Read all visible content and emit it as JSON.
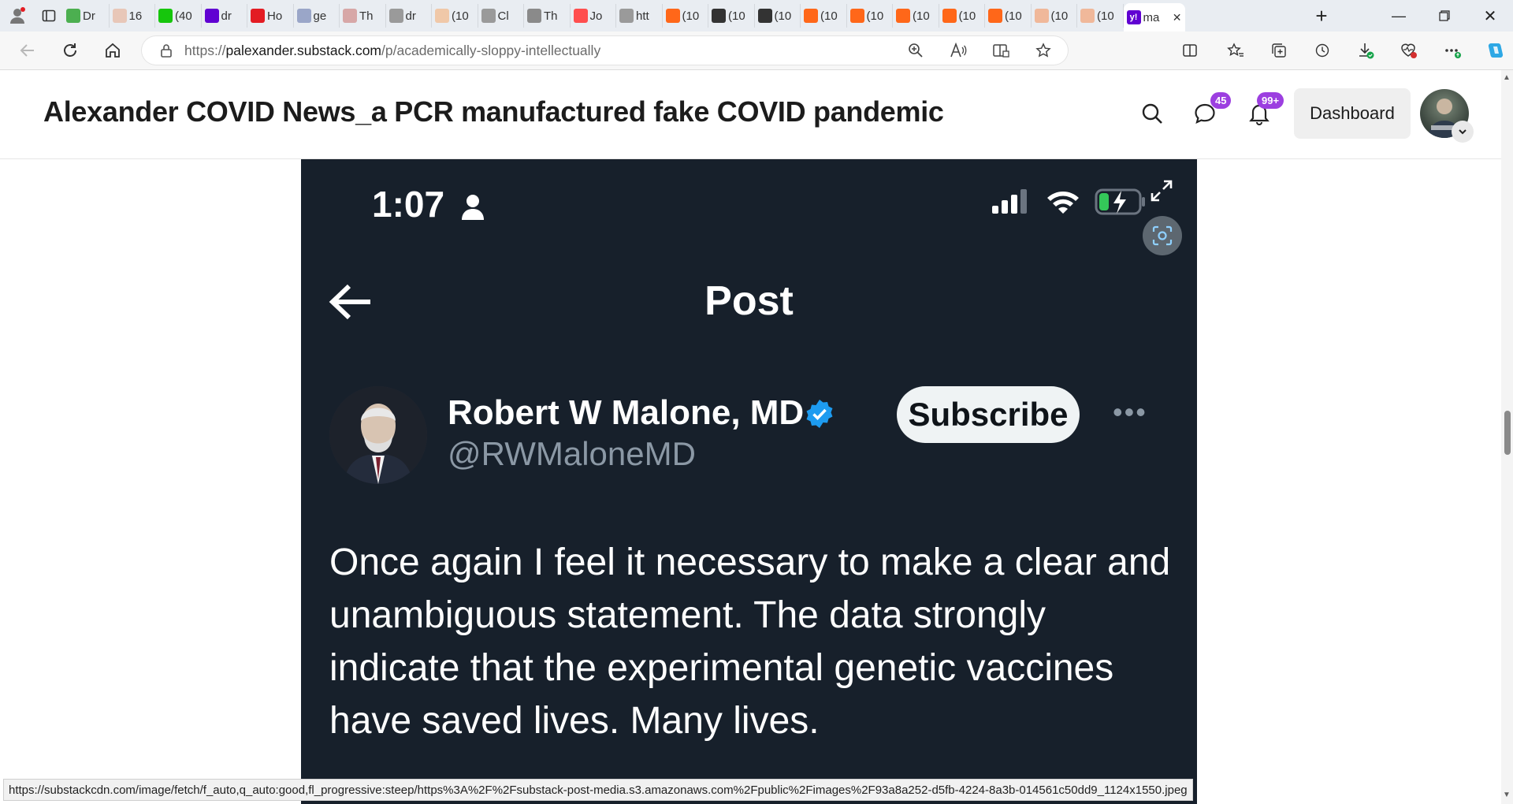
{
  "browser": {
    "tabs": [
      {
        "label": "Dr",
        "icon": "play-icon",
        "color": "#4caf50"
      },
      {
        "label": "16",
        "icon": "bi-icon",
        "color": "#e8c7b8"
      },
      {
        "label": "(40",
        "icon": "g-icon",
        "color": "#16c60c"
      },
      {
        "label": "dr",
        "icon": "yahoo-icon",
        "color": "#6001d2"
      },
      {
        "label": "Ho",
        "icon": "red-icon",
        "color": "#e31c23"
      },
      {
        "label": "ge",
        "icon": "search-icon",
        "color": "#9aa6c8"
      },
      {
        "label": "Th",
        "icon": "ds-icon",
        "color": "#d7a7a7"
      },
      {
        "label": "dr",
        "icon": "file-icon",
        "color": "#9a9a9a"
      },
      {
        "label": "(10",
        "icon": "bookmark-icon",
        "color": "#f0c8a8"
      },
      {
        "label": "Cl",
        "icon": "page-icon",
        "color": "#9a9a9a"
      },
      {
        "label": "Th",
        "icon": "tr-icon",
        "color": "#8a8a8a"
      },
      {
        "label": "Jo",
        "icon": "youtube-icon",
        "color": "#ff4e4e"
      },
      {
        "label": "htt",
        "icon": "page-icon",
        "color": "#9a9a9a"
      },
      {
        "label": "(10",
        "icon": "substack-icon",
        "color": "#ff6719"
      },
      {
        "label": "(10",
        "icon": "photo-icon",
        "color": "#333333"
      },
      {
        "label": "(10",
        "icon": "photo-icon",
        "color": "#333333"
      },
      {
        "label": "(10",
        "icon": "substack-icon",
        "color": "#ff6719"
      },
      {
        "label": "(10",
        "icon": "substack-icon",
        "color": "#ff6719"
      },
      {
        "label": "(10",
        "icon": "substack-icon",
        "color": "#ff6719"
      },
      {
        "label": "(10",
        "icon": "substack-icon",
        "color": "#ff6719"
      },
      {
        "label": "(10",
        "icon": "substack-icon",
        "color": "#ff6719"
      },
      {
        "label": "(10",
        "icon": "substack-icon",
        "color": "#f0b89a"
      },
      {
        "label": "(10",
        "icon": "substack-icon",
        "color": "#f0b89a"
      }
    ],
    "active_tab": {
      "label": "ma",
      "icon": "yahoo-icon",
      "color": "#6001d2",
      "close": "✕"
    },
    "new_tab": "+",
    "url_prefix": "https://",
    "url_host": "palexander.substack.com",
    "url_path": "/p/academically-sloppy-intellectually",
    "status_url": "https://substackcdn.com/image/fetch/f_auto,q_auto:good,fl_progressive:steep/https%3A%2F%2Fsubstack-post-media.s3.amazonaws.com%2Fpublic%2Fimages%2F93a8a252-d5fb-4224-8a3b-014561c50dd9_1124x1550.jpeg"
  },
  "header": {
    "title": "Alexander COVID News_a PCR manufactured fake COVID pandemic",
    "chat_badge": "45",
    "notif_badge": "99+",
    "dashboard_label": "Dashboard"
  },
  "post_image": {
    "time": "1:07",
    "screen_title": "Post",
    "author_name": "Robert W Malone, MD",
    "author_handle": "@RWMaloneMD",
    "subscribe_label": "Subscribe",
    "more": "•••",
    "body": "Once again I feel it necessary to make a clear and unambiguous statement. The data strongly indicate that the experimental genetic vaccines have saved lives. Many lives.",
    "accent": "#1d9bf0",
    "background": "#17202b"
  }
}
